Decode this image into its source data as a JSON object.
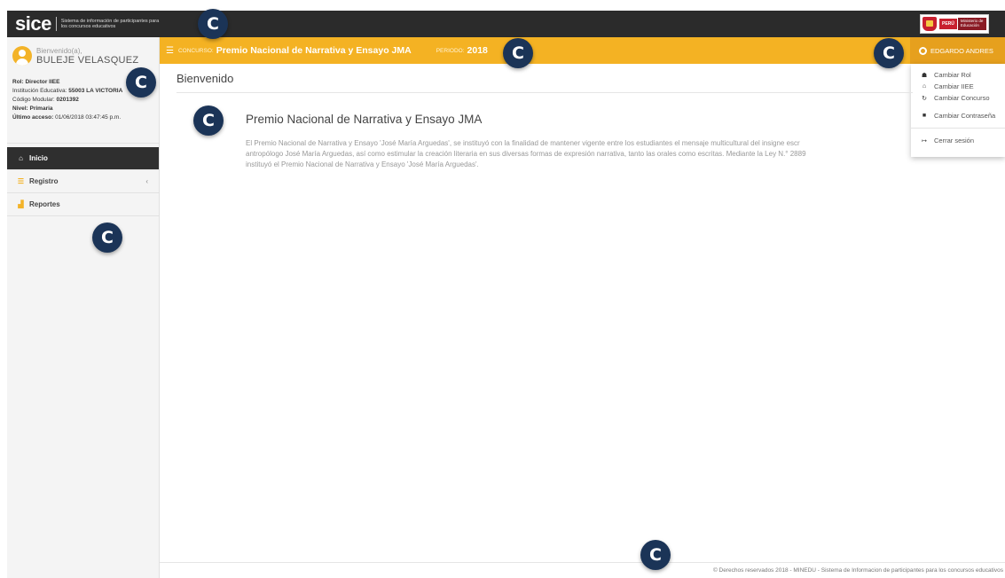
{
  "topbar": {
    "logo_word": "sice",
    "logo_tagline": "Sistema de información de participantes para los concursos educativos",
    "ministry": {
      "peru": "PERÚ",
      "name": "Ministerio de Educación"
    }
  },
  "sidebar": {
    "welcome": "Bienvenido(a),",
    "user_name": "BULEJE VELASQUEZ",
    "info": [
      {
        "key": "Rol:",
        "value": "Director IIEE"
      },
      {
        "key": "Institución Educativa:",
        "value": "55003 LA VICTORIA"
      },
      {
        "key": "Código Modular:",
        "value": "0201392"
      },
      {
        "key": "Nivel:",
        "value": "Primaria"
      },
      {
        "key": "Último acceso:",
        "value": "01/06/2018 03:47:45 p.m."
      }
    ],
    "menu": [
      {
        "label": "Inicio",
        "icon": "home-icon",
        "active": true
      },
      {
        "label": "Registro",
        "icon": "list-icon",
        "chevron": "‹"
      },
      {
        "label": "Reportes",
        "icon": "bar-chart-icon"
      }
    ]
  },
  "header": {
    "concurso_label": "CONCURSO:",
    "concurso_value": "Premio Nacional de Narrativa y Ensayo JMA",
    "periodo_label": "PERIODO:",
    "periodo_value": "2018",
    "user_menu": "EDGARDO ANDRES"
  },
  "user_dropdown": [
    {
      "label": "Cambiar Rol",
      "icon": "users-icon"
    },
    {
      "label": "Cambiar IIEE",
      "icon": "institution-icon"
    },
    {
      "label": "Cambiar Concurso",
      "icon": "refresh-icon"
    },
    {
      "label": "Cambiar Contraseña",
      "icon": "lock-icon"
    },
    {
      "label": "Cerrar sesión",
      "icon": "logout-icon"
    }
  ],
  "main": {
    "page_title": "Bienvenido",
    "article_title": "Premio Nacional de Narrativa y Ensayo JMA",
    "article_body": "El Premio Nacional de Narrativa y Ensayo 'José María Arguedas', se instituyó con la finalidad de mantener vigente entre los estudiantes el mensaje multicultural del insigne escr\nantropólogo José María Arguedas, así como estimular la creación literaria en sus diversas formas de expresión narrativa, tanto las orales como escritas. Mediante la Ley N.° 2889\ninstituyó el Premio Nacional de Narrativa y Ensayo 'José María Arguedas'."
  },
  "footer": {
    "text": "© Derechos reservados 2018 - MINEDU - Sistema de Informacion de participantes para los concursos educativos"
  },
  "badges": [
    "C",
    "C",
    "C",
    "C",
    "C",
    "C",
    "C"
  ],
  "colors": {
    "accent": "#f4b223",
    "dark": "#2b2b2b",
    "badge": "#1b3457"
  }
}
